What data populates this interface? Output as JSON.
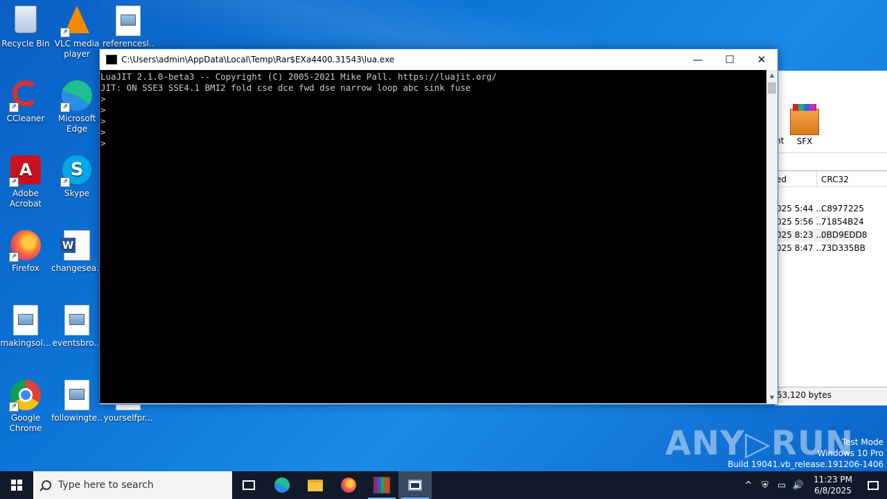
{
  "desktop": {
    "icons": [
      {
        "label": "Recycle Bin"
      },
      {
        "label": "VLC media\nplayer"
      },
      {
        "label": "referencesl..."
      },
      {
        "label": "CCleaner"
      },
      {
        "label": "Microsoft\nEdge"
      },
      {
        "label": "Adobe\nAcrobat"
      },
      {
        "label": "Skype"
      },
      {
        "label": "Firefox"
      },
      {
        "label": "changesea.rtf"
      },
      {
        "label": "makingsol..."
      },
      {
        "label": "eventsbro..."
      },
      {
        "label": "Google\nChrome"
      },
      {
        "label": "followingte..."
      },
      {
        "label": "yourselfpr..."
      }
    ]
  },
  "console_window": {
    "title": "C:\\Users\\admin\\AppData\\Local\\Temp\\Rar$EXa4400.31543\\lua.exe",
    "minimize": "—",
    "maximize": "☐",
    "close": "✕",
    "lines": [
      "LuaJIT 2.1.0-beta3 -- Copyright (C) 2005-2021 Mike Pall. https://luajit.org/",
      "JIT: ON SSE3 SSE4.1 BMI2 fold cse dce fwd dse narrow loop abc sink fuse",
      ">",
      ">",
      ">",
      ">",
      ">"
    ]
  },
  "rar_window": {
    "toolbar_partial": "nt",
    "sfx_label": "SFX",
    "columns": [
      "ed",
      "CRC32"
    ],
    "rows": [
      {
        "modified": "025 5:44 ...",
        "crc": "C8977225"
      },
      {
        "modified": "025 5:56 ...",
        "crc": "71854B24"
      },
      {
        "modified": "025 8:23 ...",
        "crc": "0BD9EDD8"
      },
      {
        "modified": "025 8:47 ...",
        "crc": "73D335BB"
      }
    ],
    "status": "53,120 bytes"
  },
  "watermark": {
    "brand": "ANY▷RUN",
    "line1": "Test Mode",
    "line2": "Windows 10 Pro",
    "line3": "Build 19041.vb_release.191206-1406"
  },
  "taskbar": {
    "search_placeholder": "Type here to search",
    "time": "11:23 PM",
    "date": "6/8/2025",
    "tray_icons": [
      "^",
      "⛨",
      "▭",
      "🔊"
    ]
  }
}
